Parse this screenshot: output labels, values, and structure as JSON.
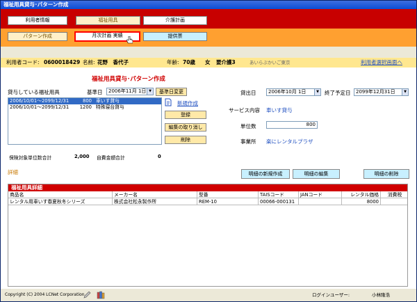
{
  "window": {
    "title": "福祉用具貸与･パターン作成"
  },
  "nav": {
    "user_info": "利用者情報",
    "welfare_equipment": "福祉用具",
    "care_plan": "介護計画",
    "pattern_create": "パターン作成",
    "monthly_plan": "月次計画 実績",
    "provision_form": "提供票"
  },
  "patient": {
    "code_label": "利用者コード:",
    "code": "0600018429",
    "name_label": "名前:",
    "name": "花野　香代子",
    "age_label": "年齢:",
    "age": "70歳",
    "gender": "女",
    "care_level": "要介護3",
    "office": "あいらぶかいご東京",
    "select_link": "利用者選択画面へ"
  },
  "page": {
    "title": "福祉用具貸与･パターン作成"
  },
  "left": {
    "section_label": "貸与している福祉用具",
    "base_date_label": "基準日",
    "base_date": "2006年11月 1日",
    "change_base_date": "基準日変更",
    "items": [
      {
        "period": "2006/10/01～2099/12/31",
        "units": "800",
        "name": "車いす貸与",
        "selected": true
      },
      {
        "period": "2006/10/01～2099/12/31",
        "units": "1200",
        "name": "特殊寝台貸与",
        "selected": false
      }
    ],
    "new_create": "新規作成",
    "register": "登録",
    "cancel_edit": "編集の取り消し",
    "delete": "削除",
    "insured_units_label": "保険対象単位数合計",
    "insured_units": "2,000",
    "self_pay_label": "自費金額合計",
    "self_pay": "0"
  },
  "right": {
    "lend_date_label": "貸出日",
    "lend_date": "2006年10月 1日",
    "end_date_label": "終了予定日",
    "end_date": "2099年12月31日",
    "service_label": "サービス内容",
    "service_value": "車いす貸与",
    "units_label": "単位数",
    "units_value": "800",
    "office_label": "事業所",
    "office_value": "楽にレンタルプラザ"
  },
  "detail": {
    "label": "詳細",
    "new_detail": "明細の新規作成",
    "edit_detail": "明細の編集",
    "delete_detail": "明細の削除",
    "table_title": "福祉用具詳細",
    "columns": [
      "商品名",
      "メーカー名",
      "型番",
      "TAISコード",
      "JANコード",
      "レンタル価格",
      "消費税"
    ],
    "rows": [
      [
        "レンタル用車いす春夏秋冬シリーズ",
        "株式会社松永製作所",
        "REM-10",
        "00066-000131",
        "",
        "8000",
        ""
      ]
    ]
  },
  "footer": {
    "copyright": "Copyright (C) 2004 LCNet Corporation",
    "login_label": "ログインユーザー:",
    "login_user": "小林隆浩"
  }
}
